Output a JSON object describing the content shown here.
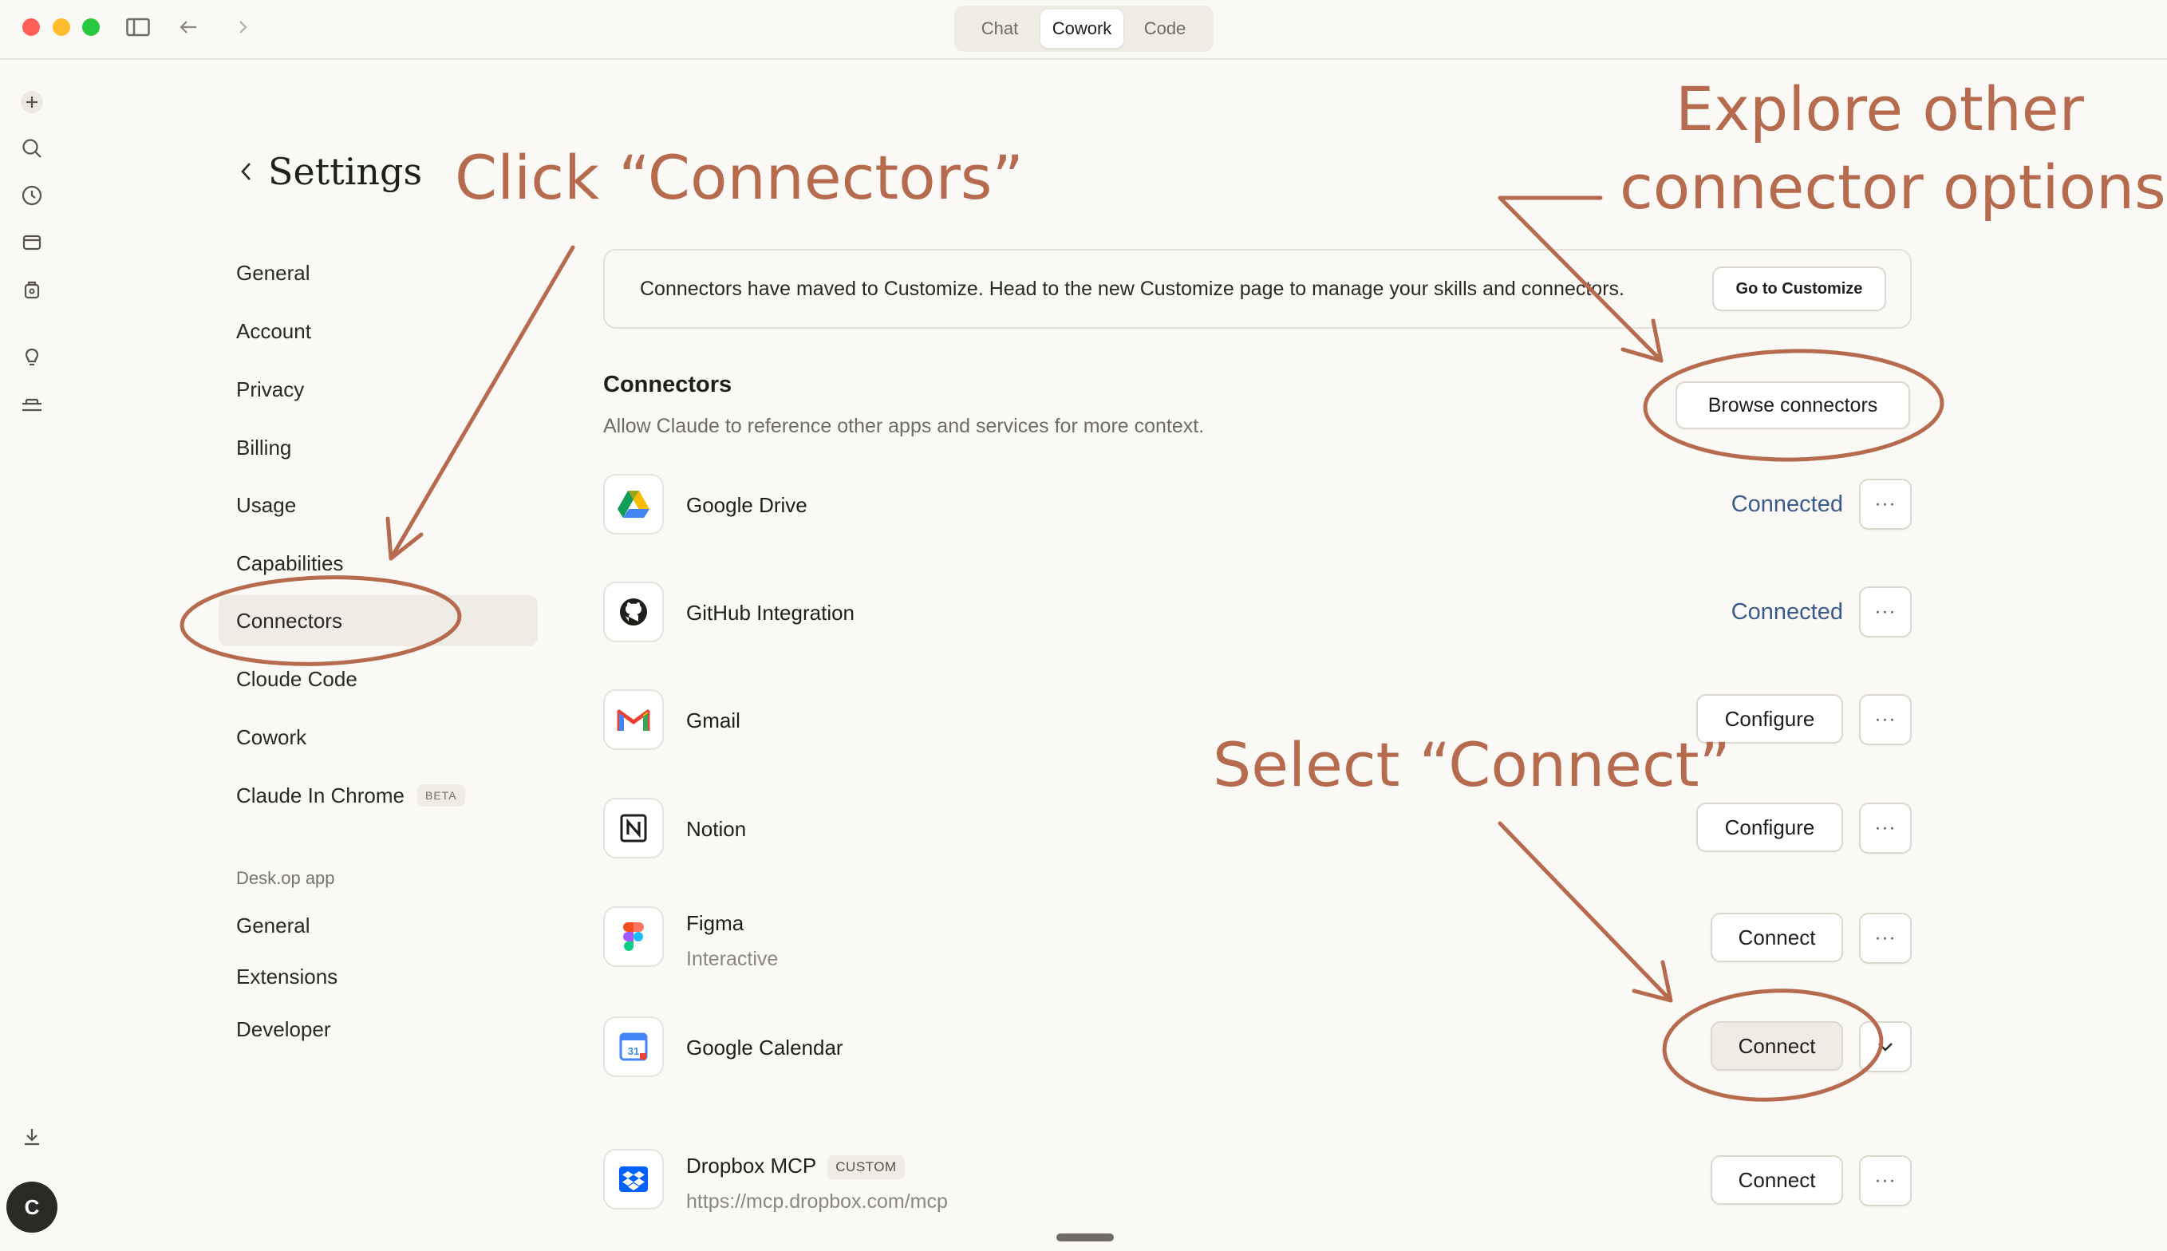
{
  "window": {
    "tabs": [
      {
        "label": "Chat"
      },
      {
        "label": "Cowork"
      },
      {
        "label": "Code"
      }
    ],
    "active_tab": "Cowork"
  },
  "rail": {
    "icons": [
      "plus-icon",
      "search-icon",
      "clock-icon",
      "window-icon",
      "bag-icon",
      "lightbulb-icon",
      "tools-icon",
      "download-icon"
    ],
    "avatar_letter": "C"
  },
  "settings": {
    "title": "Settings",
    "nav": [
      {
        "label": "General"
      },
      {
        "label": "Account"
      },
      {
        "label": "Privacy"
      },
      {
        "label": "Billing"
      },
      {
        "label": "Usage"
      },
      {
        "label": "Capabilities"
      },
      {
        "label": "Connectors"
      },
      {
        "label": "Cloude Code"
      },
      {
        "label": "Cowork"
      },
      {
        "label": "Claude In Chrome",
        "badge": "BETA"
      }
    ],
    "desktop_section": "Desk.op app",
    "desktop_nav": [
      {
        "label": "General"
      },
      {
        "label": "Extensions"
      },
      {
        "label": "Developer"
      }
    ]
  },
  "banner": {
    "text": "Connectors have maved to Customize. Head to the new Customize page to manage your skills and connectors.",
    "button": "Go to Customize"
  },
  "connectors": {
    "title": "Connectors",
    "description": "Allow Claude to reference other apps and services for more context.",
    "browse_button": "Browse connectors",
    "items": [
      {
        "name": "Google Drive",
        "status": "Connected",
        "icon": "google-drive-icon"
      },
      {
        "name": "GitHub Integration",
        "status": "Connected",
        "icon": "github-icon"
      },
      {
        "name": "Gmail",
        "action": "Configure",
        "icon": "gmail-icon"
      },
      {
        "name": "Notion",
        "action": "Configure",
        "icon": "notion-icon"
      },
      {
        "name": "Figma",
        "subtitle": "Interactive",
        "action": "Connect",
        "icon": "figma-icon"
      },
      {
        "name": "Google Calendar",
        "action": "Connect",
        "icon": "google-calendar-icon"
      },
      {
        "name": "Dropbox MCP",
        "badge": "CUSTOM",
        "subtitle": "https://mcp.dropbox.com/mcp",
        "action": "Connect",
        "icon": "dropbox-icon"
      }
    ],
    "more_label": "···"
  },
  "annotations": {
    "click_connectors": "Click “Connectors”",
    "explore_line1": "Explore other",
    "explore_line2": "connector options",
    "select_connect": "Select “Connect”"
  },
  "colors": {
    "background": "#faf9f5",
    "annotation": "#b66a4e",
    "connected_text": "#3a5a8c"
  }
}
